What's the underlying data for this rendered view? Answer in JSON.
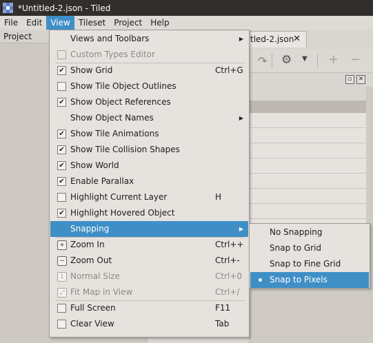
{
  "window": {
    "title": "*Untitled-2.json - Tiled"
  },
  "menubar": [
    {
      "label": "File",
      "active": false
    },
    {
      "label": "Edit",
      "active": false
    },
    {
      "label": "View",
      "active": true
    },
    {
      "label": "Tileset",
      "active": false
    },
    {
      "label": "Project",
      "active": false
    },
    {
      "label": "Help",
      "active": false
    }
  ],
  "background": {
    "left_dock_title": "Project",
    "doc_tab_label": "tled-2.json",
    "doc_tab_close": "✕"
  },
  "view_menu": {
    "items": [
      {
        "label": "Views and Toolbars",
        "kind": "submenu",
        "enabled": true
      },
      {
        "label": "Custom Types Editor",
        "kind": "check",
        "checked": false,
        "enabled": false
      },
      {
        "label": "Show Grid",
        "kind": "check",
        "checked": true,
        "shortcut": "Ctrl+G",
        "enabled": true
      },
      {
        "label": "Show Tile Object Outlines",
        "kind": "check",
        "checked": false,
        "enabled": true
      },
      {
        "label": "Show Object References",
        "kind": "check",
        "checked": true,
        "enabled": true
      },
      {
        "label": "Show Object Names",
        "kind": "submenu",
        "enabled": true
      },
      {
        "label": "Show Tile Animations",
        "kind": "check",
        "checked": true,
        "enabled": true
      },
      {
        "label": "Show Tile Collision Shapes",
        "kind": "check",
        "checked": true,
        "enabled": true
      },
      {
        "label": "Show World",
        "kind": "check",
        "checked": true,
        "enabled": true
      },
      {
        "label": "Enable Parallax",
        "kind": "check",
        "checked": true,
        "enabled": true
      },
      {
        "label": "Highlight Current Layer",
        "kind": "check",
        "checked": false,
        "shortcut": "H",
        "enabled": true
      },
      {
        "label": "Highlight Hovered Object",
        "kind": "check",
        "checked": true,
        "enabled": true
      },
      {
        "label": "Snapping",
        "kind": "submenu",
        "enabled": true,
        "highlighted": true
      },
      {
        "label": "Zoom In",
        "kind": "icon",
        "icon": "zoom-in-icon",
        "shortcut": "Ctrl++",
        "enabled": true
      },
      {
        "label": "Zoom Out",
        "kind": "icon",
        "icon": "zoom-out-icon",
        "shortcut": "Ctrl+-",
        "enabled": true
      },
      {
        "label": "Normal Size",
        "kind": "icon",
        "icon": "normal-size-icon",
        "shortcut": "Ctrl+0",
        "enabled": false
      },
      {
        "label": "Fit Map in View",
        "kind": "icon",
        "icon": "fit-map-icon",
        "shortcut": "Ctrl+/",
        "enabled": false
      },
      {
        "label": "Full Screen",
        "kind": "check",
        "checked": false,
        "shortcut": "F11",
        "enabled": true
      },
      {
        "label": "Clear View",
        "kind": "check",
        "checked": false,
        "shortcut": "Tab",
        "enabled": true
      }
    ]
  },
  "snapping_menu": {
    "items": [
      {
        "label": "No Snapping",
        "selected": false
      },
      {
        "label": "Snap to Grid",
        "selected": false
      },
      {
        "label": "Snap to Fine Grid",
        "selected": false
      },
      {
        "label": "Snap to Pixels",
        "selected": true
      }
    ]
  },
  "colors": {
    "highlight": "#3f8fc6",
    "titlebar": "#322e2c",
    "menu_bg": "#e6e2de"
  }
}
